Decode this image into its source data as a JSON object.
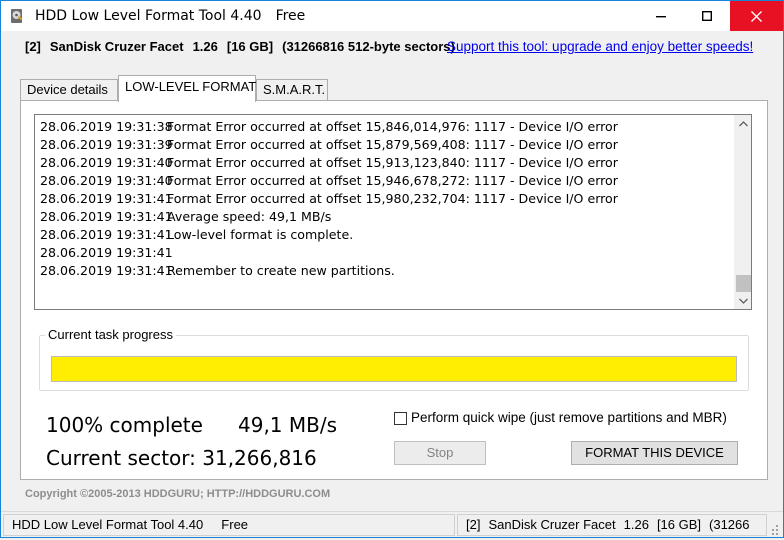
{
  "window": {
    "title": "HDD Low Level Format Tool 4.40",
    "edition": "Free",
    "icons": {
      "app": "hdd-app-icon",
      "minimize": "minimize-icon",
      "maximize": "maximize-icon",
      "close": "close-icon"
    }
  },
  "device_info": {
    "index": "[2]",
    "model": "SanDisk Cruzer Facet",
    "firmware": "1.26",
    "size": "[16 GB]",
    "sectors": "(31266816 512-byte sectors)"
  },
  "support_link": "Support this tool: upgrade and enjoy better speeds!",
  "tabs": [
    {
      "label": "Device details",
      "active": false
    },
    {
      "label": "LOW-LEVEL FORMAT",
      "active": true
    },
    {
      "label": "S.M.A.R.T.",
      "active": false
    }
  ],
  "log": [
    {
      "ts": "28.06.2019 19:31:38",
      "msg": "Format Error occurred at offset 15,846,014,976:  1117 - Device I/O error"
    },
    {
      "ts": "28.06.2019 19:31:39",
      "msg": "Format Error occurred at offset 15,879,569,408:  1117 - Device I/O error"
    },
    {
      "ts": "28.06.2019 19:31:40",
      "msg": "Format Error occurred at offset 15,913,123,840:  1117 - Device I/O error"
    },
    {
      "ts": "28.06.2019 19:31:40",
      "msg": "Format Error occurred at offset 15,946,678,272:  1117 - Device I/O error"
    },
    {
      "ts": "28.06.2019 19:31:41",
      "msg": "Format Error occurred at offset 15,980,232,704:  1117 - Device I/O error"
    },
    {
      "ts": "28.06.2019 19:31:41",
      "msg": "Average speed: 49,1 MB/s"
    },
    {
      "ts": "28.06.2019 19:31:41",
      "msg": "Low-level format is complete."
    },
    {
      "ts": "28.06.2019 19:31:41",
      "msg": ""
    },
    {
      "ts": "28.06.2019 19:31:41",
      "msg": "Remember to create new partitions."
    }
  ],
  "progress": {
    "label": "Current task progress",
    "fraction": 1.0,
    "fill_color": "#ffee00",
    "percent_text": "100% complete",
    "speed_text": "49,1 MB/s",
    "sector_text": "Current sector: 31,266,816"
  },
  "options": {
    "quick_wipe_label": "Perform quick wipe (just remove partitions and MBR)",
    "quick_wipe_checked": false
  },
  "buttons": {
    "stop": "Stop",
    "format": "FORMAT THIS DEVICE"
  },
  "copyright": "Copyright ©2005-2013 HDDGURU;  HTTP://HDDGURU.COM",
  "statusbar": {
    "left": "HDD Low Level Format Tool 4.40     Free",
    "right": {
      "index": "[2]",
      "model": "SanDisk Cruzer Facet",
      "firmware": "1.26",
      "size": "[16 GB]",
      "sectors": "(31266"
    }
  }
}
